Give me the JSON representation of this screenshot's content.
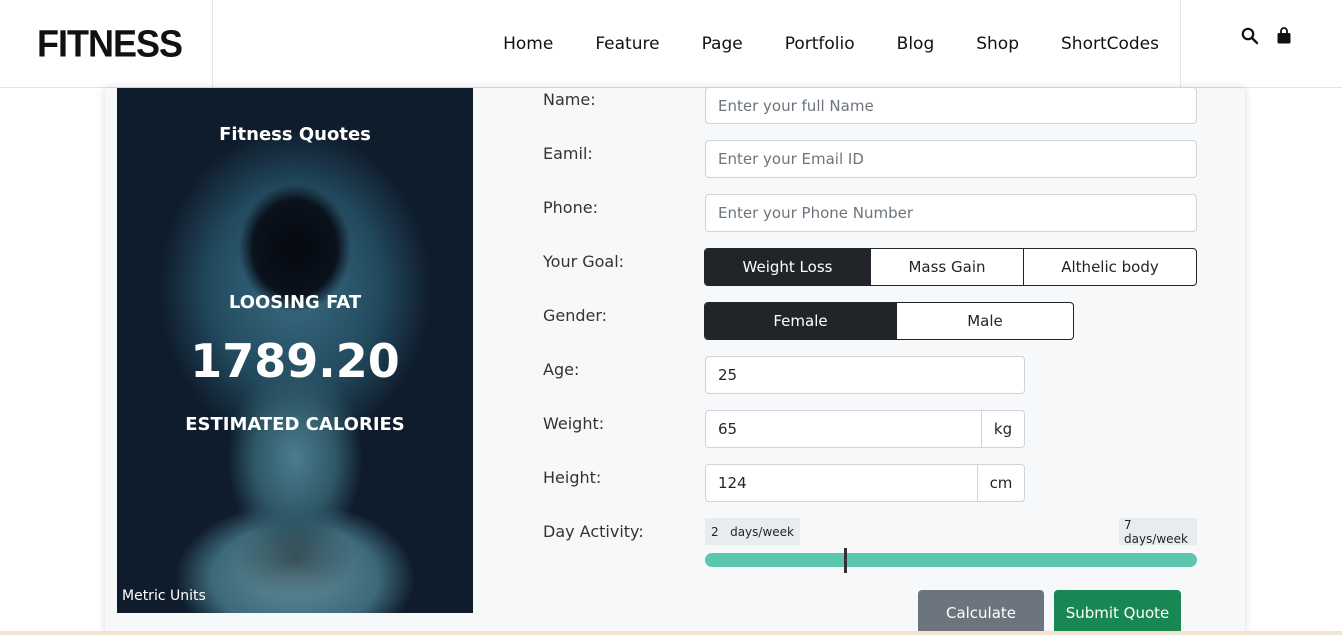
{
  "brand": {
    "logo": "FITNESS"
  },
  "nav": {
    "items": [
      "Home",
      "Feature",
      "Page",
      "Portfolio",
      "Blog",
      "Shop",
      "ShortCodes"
    ]
  },
  "header_icons": [
    "search-icon",
    "shopping-bag-icon"
  ],
  "hero": {
    "title": "Fitness Quotes",
    "goal_text": "LOOSING FAT",
    "calories": "1789.20",
    "calories_label": "ESTIMATED CALORIES",
    "units": "Metric Units"
  },
  "form": {
    "name": {
      "label": "Name:",
      "placeholder": "Enter your full Name"
    },
    "email": {
      "label": "Eamil:",
      "placeholder": "Enter your Email ID"
    },
    "phone": {
      "label": "Phone:",
      "placeholder": "Enter your Phone Number"
    },
    "goal": {
      "label": "Your Goal:",
      "options": [
        "Weight Loss",
        "Mass Gain",
        "Althelic body"
      ],
      "selected": "Weight Loss"
    },
    "gender": {
      "label": "Gender:",
      "options": [
        "Female",
        "Male"
      ],
      "selected": "Female"
    },
    "age": {
      "label": "Age:",
      "value": "25"
    },
    "weight": {
      "label": "Weight:",
      "value": "65",
      "unit": "kg"
    },
    "height": {
      "label": "Height:",
      "value": "124",
      "unit": "cm"
    },
    "activity": {
      "label": "Day Activity:",
      "min_label": "2   days/week",
      "max_label": "7 days/week",
      "value_days": 2
    }
  },
  "buttons": {
    "calculate": "Calculate",
    "submit": "Submit Quote"
  },
  "colors": {
    "dark": "#212529",
    "slider": "#5bc7ae",
    "calculate": "#6c757d",
    "submit": "#198754"
  }
}
